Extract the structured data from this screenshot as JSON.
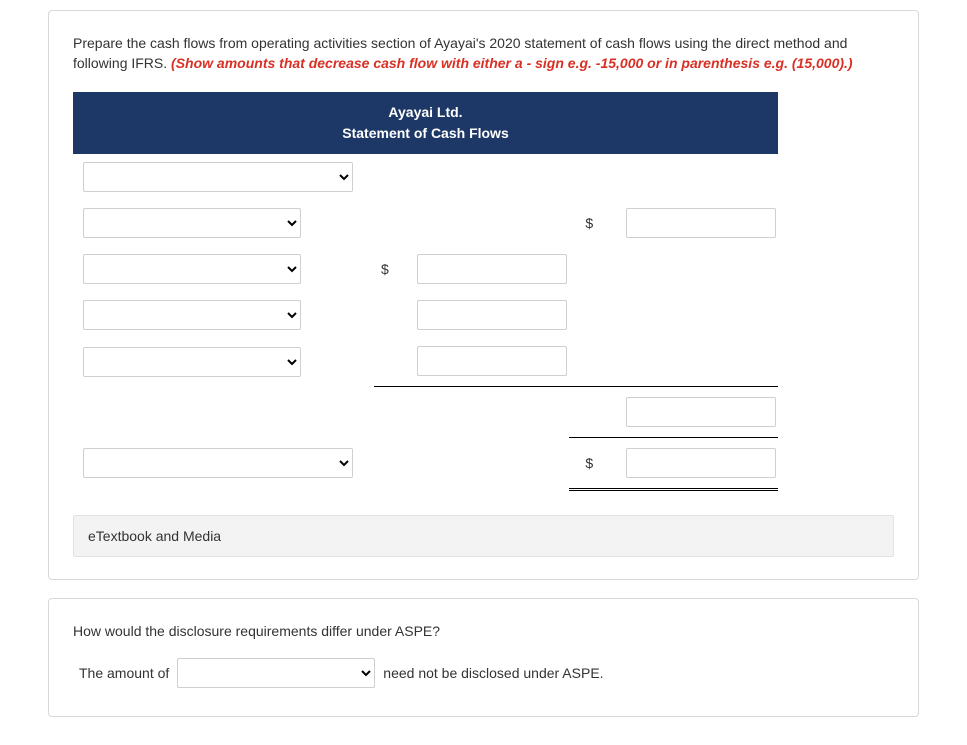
{
  "instruction": {
    "text": "Prepare the cash flows from operating activities section of Ayayai's 2020 statement of cash flows using the direct method and following IFRS. ",
    "hint": "(Show amounts that decrease cash flow with either a - sign e.g. -15,000 or in parenthesis e.g. (15,000).)"
  },
  "header": {
    "company": "Ayayai Ltd.",
    "title": "Statement of Cash Flows"
  },
  "rows": {
    "r1_options": [
      ""
    ],
    "r2_options": [
      ""
    ],
    "r3_options": [
      ""
    ],
    "r4_options": [
      ""
    ],
    "r5_options": [
      ""
    ],
    "r7_options": [
      ""
    ]
  },
  "currency": "$",
  "media_label": "eTextbook and Media",
  "q2": {
    "prompt": "How would the disclosure requirements differ under ASPE?",
    "prefix": "The amount of",
    "suffix": "need not be disclosed under ASPE.",
    "options": [
      ""
    ]
  }
}
